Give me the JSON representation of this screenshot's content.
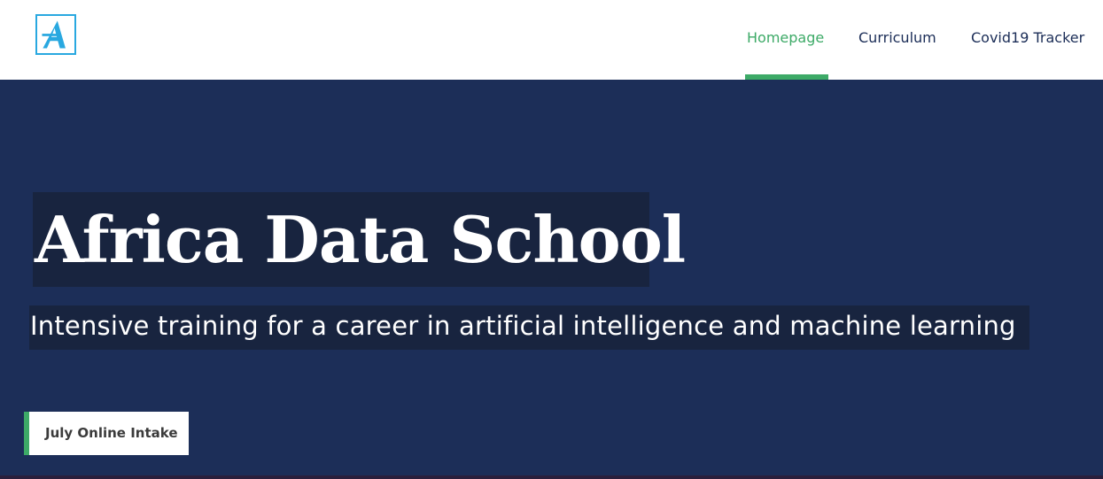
{
  "header": {
    "logo": {
      "icon": "letter-a-logo-icon",
      "color": "#29a8e0"
    },
    "nav": [
      {
        "label": "Homepage",
        "active": true
      },
      {
        "label": "Curriculum",
        "active": false
      },
      {
        "label": "Covid19 Tracker",
        "active": false
      }
    ]
  },
  "hero": {
    "title": "Africa Data School",
    "subtitle": "Intensive training for a career in artificial intelligence and machine learning",
    "cta_label": "July Online Intake"
  },
  "colors": {
    "navy_background": "#1c2e58",
    "text_highlight": "#18243f",
    "accent_green": "#3daa67",
    "nav_text": "#1b2d57",
    "logo_blue": "#29a8e0"
  }
}
